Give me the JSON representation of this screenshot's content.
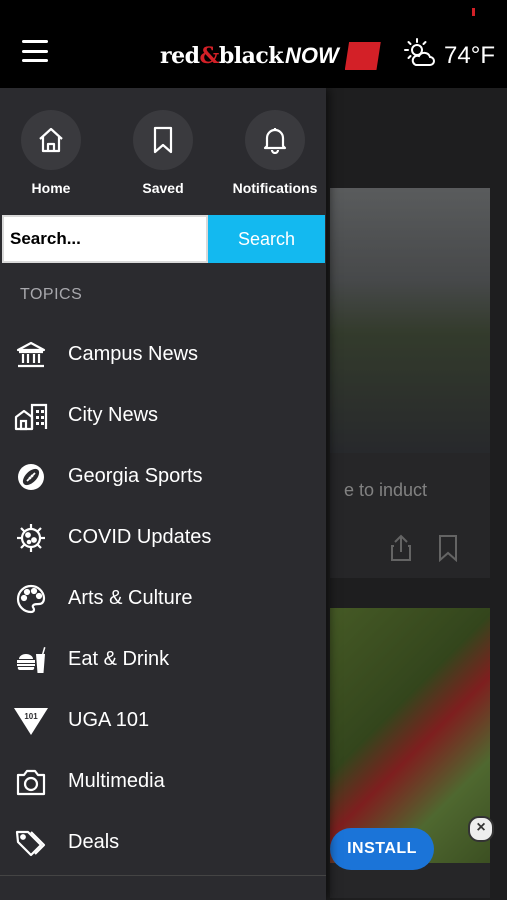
{
  "header": {
    "brand": {
      "part1": "red",
      "amp": "&",
      "part2": "black",
      "now": "NOW"
    },
    "weather": {
      "icon": "sun-cloud-icon",
      "temperature": "74°F"
    },
    "accent_color": "#d32027"
  },
  "drawer": {
    "quick_links": [
      {
        "label": "Home",
        "icon": "home-icon"
      },
      {
        "label": "Saved",
        "icon": "bookmark-icon"
      },
      {
        "label": "Notifications",
        "icon": "bell-icon"
      }
    ],
    "search": {
      "placeholder": "Search...",
      "button_label": "Search",
      "button_color": "#13b9f0"
    },
    "topics_heading": "TOPICS",
    "topics": [
      {
        "label": "Campus News",
        "icon": "building-columns-icon"
      },
      {
        "label": "City News",
        "icon": "city-buildings-icon"
      },
      {
        "label": "Georgia Sports",
        "icon": "football-icon"
      },
      {
        "label": "COVID Updates",
        "icon": "virus-icon"
      },
      {
        "label": "Arts & Culture",
        "icon": "palette-icon"
      },
      {
        "label": "Eat & Drink",
        "icon": "food-drink-icon"
      },
      {
        "label": "UGA 101",
        "icon": "uga-101-pennant-icon"
      },
      {
        "label": "Multimedia",
        "icon": "camera-icon"
      },
      {
        "label": "Deals",
        "icon": "tags-icon"
      }
    ]
  },
  "background": {
    "article_snippet": "e to induct",
    "install_label": "INSTALL"
  }
}
